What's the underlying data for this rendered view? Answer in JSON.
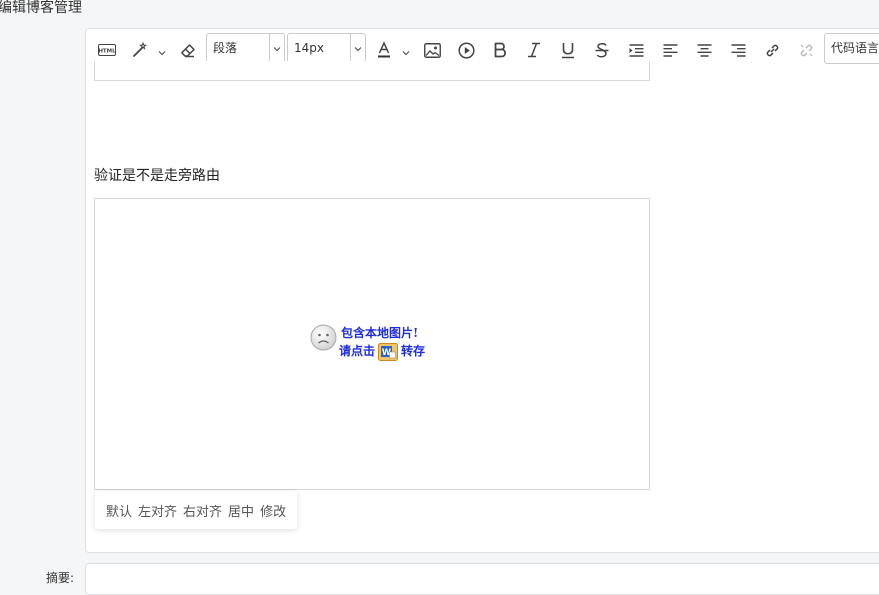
{
  "page": {
    "title": "编辑博客管理"
  },
  "toolbar": {
    "paragraph_select": "段落",
    "font_size_select": "14px",
    "code_language_select": "代码语言"
  },
  "content": {
    "paragraph_text": "验证是不是走旁路由",
    "image_placeholder": {
      "line1": "包含本地图片!",
      "line2_prefix": "请点击",
      "line2_suffix": "转存"
    }
  },
  "align_menu": {
    "items": [
      "默认",
      "左对齐",
      "右对齐",
      "居中",
      "修改"
    ]
  },
  "summary": {
    "label": "摘要:"
  },
  "icons": [
    "html-icon",
    "magic-wand-icon",
    "eraser-icon",
    "font-color-icon",
    "image-icon",
    "video-icon",
    "bold-icon",
    "italic-icon",
    "underline-icon",
    "strikethrough-icon",
    "indent-icon",
    "align-left-icon",
    "align-center-icon",
    "align-right-icon",
    "link-icon",
    "unlink-icon",
    "sad-face-icon",
    "word-icon"
  ],
  "colors": {
    "placeholder_text": "#1e2ddb",
    "border": "#dcdfe6"
  }
}
